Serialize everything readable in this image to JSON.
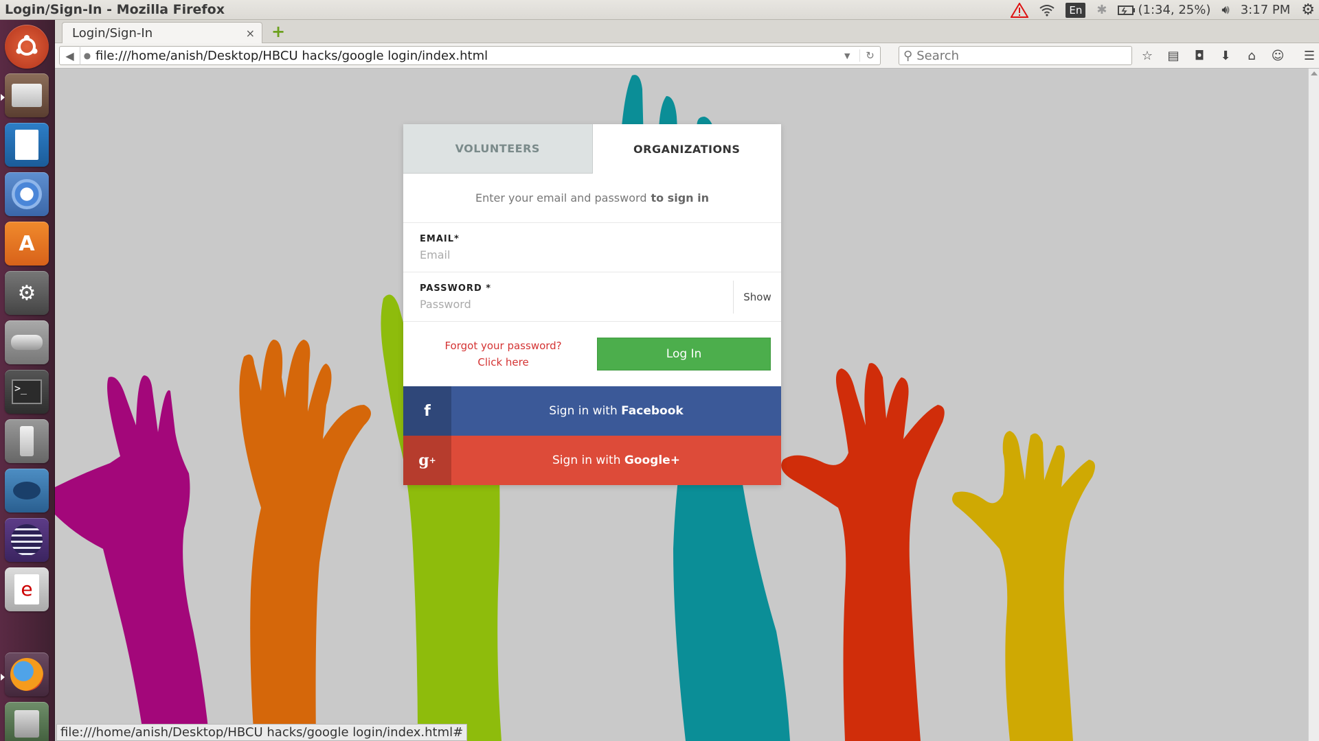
{
  "window": {
    "title": "Login/Sign-In - Mozilla Firefox"
  },
  "indicators": {
    "battery": "(1:34, 25%)",
    "lang": "En",
    "time": "3:17 PM"
  },
  "browser": {
    "tab_title": "Login/Sign-In",
    "tab_close": "×",
    "new_tab": "+",
    "url": "file:///home/anish/Desktop/HBCU hacks/google login/index.html",
    "search_placeholder": "Search",
    "status_url": "file:///home/anish/Desktop/HBCU hacks/google login/index.html#"
  },
  "login": {
    "tab_volunteers": "VOLUNTEERS",
    "tab_organizations": "ORGANIZATIONS",
    "intro_text": "Enter your email and password",
    "intro_bold": "to sign in",
    "email_label": "EMAIL*",
    "email_placeholder": "Email",
    "password_label": "PASSWORD *",
    "password_placeholder": "Password",
    "show_label": "Show",
    "forgot_line1": "Forgot your password?",
    "forgot_line2": "Click here",
    "login_button": "Log In",
    "facebook_prefix": "Sign in with",
    "facebook_name": "Facebook",
    "google_prefix": "Sign in with",
    "google_name": "Google+"
  },
  "colors": {
    "background": "#c9c9c9",
    "hand_magenta": "#a3077a",
    "hand_orange": "#d5670a",
    "hand_lime": "#8ebc0c",
    "hand_teal": "#0b8e97",
    "hand_red": "#d02d0a",
    "hand_yellow": "#cfa903",
    "login_green": "#4cae4c",
    "facebook_blue": "#3b5998",
    "google_red": "#dd4b39"
  }
}
